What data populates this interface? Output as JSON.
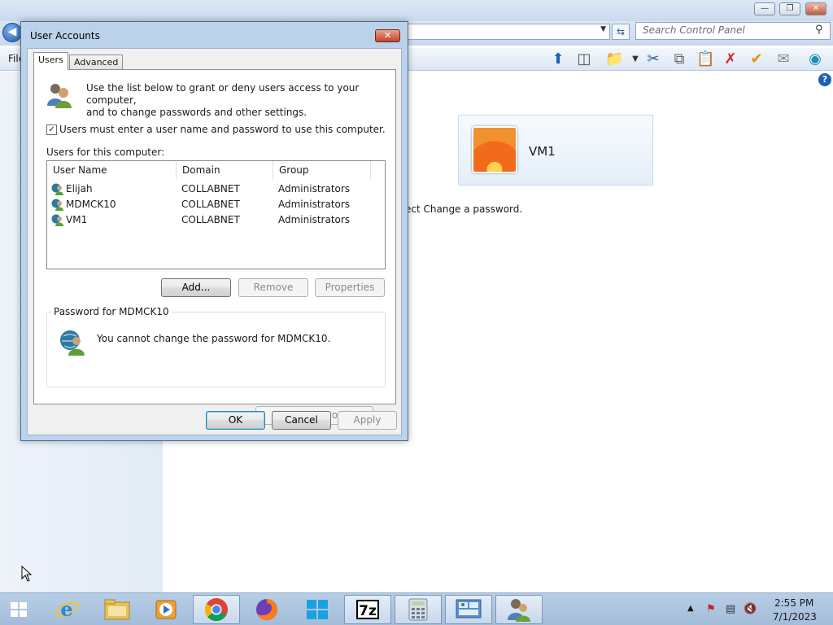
{
  "control_panel": {
    "search_placeholder": "Search Control Panel",
    "menu_file": "File",
    "user_tile_name": "VM1",
    "instruction_partial": "ect Change a password."
  },
  "dialog": {
    "title": "User Accounts",
    "tabs": [
      "Users",
      "Advanced"
    ],
    "intro_line1": "Use the list below to grant or deny users access to your computer,",
    "intro_line2": "and to change passwords and other settings.",
    "must_enter_label": "Users must enter a user name and password to use this computer.",
    "must_enter_checked": true,
    "users_label": "Users for this computer:",
    "columns": [
      "User Name",
      "Domain",
      "Group"
    ],
    "users": [
      {
        "name": "Elijah",
        "domain": "COLLABNET",
        "group": "Administrators"
      },
      {
        "name": "MDMCK10",
        "domain": "COLLABNET",
        "group": "Administrators"
      },
      {
        "name": "VM1",
        "domain": "COLLABNET",
        "group": "Administrators"
      }
    ],
    "buttons": {
      "add": "Add...",
      "remove": "Remove",
      "properties": "Properties",
      "reset_password": "Reset Password...",
      "ok": "OK",
      "cancel": "Cancel",
      "apply": "Apply"
    },
    "password_group_title": "Password for MDMCK10",
    "password_message": "You cannot change the password for MDMCK10."
  },
  "taskbar": {
    "apps": [
      "internet-explorer",
      "file-explorer",
      "media-player",
      "chrome",
      "firefox",
      "windows-store",
      "7zip",
      "calculator",
      "control-panel",
      "user-accounts"
    ],
    "clock_time": "2:55 PM",
    "clock_date": "7/1/2023"
  },
  "colors": {
    "dialog_frame": "#bcd2ea",
    "taskbar": "#b8cee6",
    "accent": "#1f5fb3"
  }
}
